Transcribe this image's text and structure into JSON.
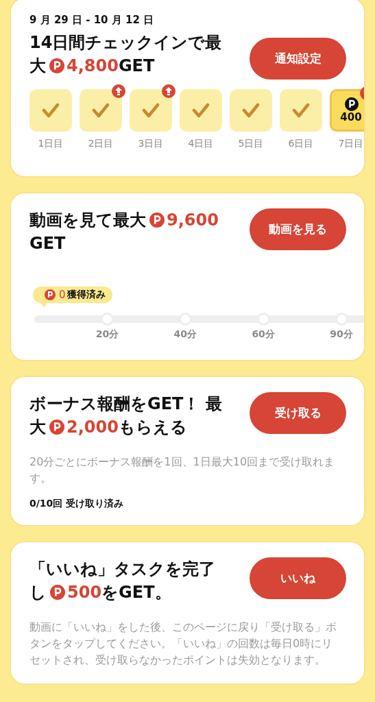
{
  "checkin": {
    "period": "9 月 29 日 - 10 月 12 日",
    "button": "通知設定",
    "title_lines": [
      [
        {
          "kind": "text",
          "text": "14日間チェックインで最"
        }
      ],
      [
        {
          "kind": "text",
          "text": "大"
        },
        {
          "kind": "points",
          "text": "4,800"
        },
        {
          "kind": "text",
          "text": "GET"
        }
      ]
    ],
    "days": [
      {
        "label": "1日目",
        "kind": "checked",
        "boost": false
      },
      {
        "label": "2日目",
        "kind": "checked",
        "boost": true
      },
      {
        "label": "3日目",
        "kind": "checked",
        "boost": true
      },
      {
        "label": "4日目",
        "kind": "checked",
        "boost": false
      },
      {
        "label": "5日目",
        "kind": "checked",
        "boost": false
      },
      {
        "label": "6日目",
        "kind": "checked",
        "boost": false
      },
      {
        "label": "7日目",
        "kind": "reward",
        "reward": "400",
        "boost": true
      }
    ]
  },
  "video": {
    "button": "動画を見る",
    "earned": "0",
    "earned_label": "獲得済み",
    "title_lines": [
      [
        {
          "kind": "text",
          "text": "動画を見て最大"
        },
        {
          "kind": "points",
          "text": "9,600"
        }
      ],
      [
        {
          "kind": "text",
          "text": "GET"
        }
      ]
    ],
    "milestones": [
      "20分",
      "40分",
      "60分",
      "90分"
    ]
  },
  "bonus": {
    "button": "受け取る",
    "description": "20分ごとにボーナス報酬を1回、1日最大10回まで受け取れます。",
    "status": "0/10回 受け取り済み",
    "title_lines": [
      [
        {
          "kind": "text",
          "text": "ボーナス報酬をGET！ 最"
        }
      ],
      [
        {
          "kind": "text",
          "text": "大"
        },
        {
          "kind": "points",
          "text": "2,000"
        },
        {
          "kind": "text",
          "text": "もらえる"
        }
      ]
    ]
  },
  "like": {
    "button": "いいね",
    "description": "動画に「いいね」をした後、このページに戻り「受け取る」ボタンをタップしてください。「いいね」の回数は毎日0時にリセットされ、受け取らなかったポイントは失効となります。",
    "title_lines": [
      [
        {
          "kind": "text",
          "text": "「いいね」タスクを完了"
        }
      ],
      [
        {
          "kind": "text",
          "text": "し"
        },
        {
          "kind": "points",
          "text": "500"
        },
        {
          "kind": "text",
          "text": "をGET。"
        }
      ]
    ]
  }
}
